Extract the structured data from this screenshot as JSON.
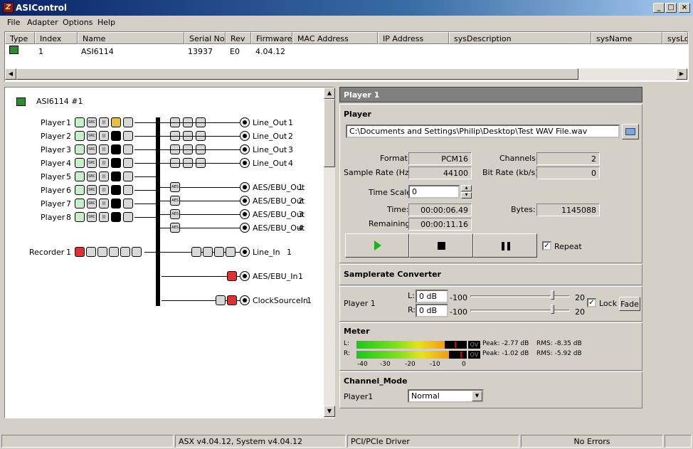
{
  "window": {
    "title": "ASIControl",
    "minimize": "_",
    "maximize": "□",
    "close": "×"
  },
  "menu": [
    "File",
    "Adapter",
    "Options",
    "Help"
  ],
  "devices": {
    "columns": [
      "Type",
      "Index",
      "Name",
      "Serial No.",
      "Rev",
      "Firmware",
      "MAC Address",
      "IP Address",
      "sysDescription",
      "sysName",
      "sysLo"
    ],
    "rows": [
      {
        "index": "1",
        "name": "ASI6114",
        "serial": "13937",
        "rev": "E0",
        "firmware": "4.04.12"
      }
    ]
  },
  "routing": {
    "adapter": "ASI6114 #1",
    "players": [
      {
        "label": "Player",
        "num": "1"
      },
      {
        "label": "Player",
        "num": "2"
      },
      {
        "label": "Player",
        "num": "3"
      },
      {
        "label": "Player",
        "num": "4"
      },
      {
        "label": "Player",
        "num": "5"
      },
      {
        "label": "Player",
        "num": "6"
      },
      {
        "label": "Player",
        "num": "7"
      },
      {
        "label": "Player",
        "num": "8"
      }
    ],
    "outputs": [
      {
        "label": "Line_Out",
        "num": "1"
      },
      {
        "label": "Line_Out",
        "num": "2"
      },
      {
        "label": "Line_Out",
        "num": "3"
      },
      {
        "label": "Line_Out",
        "num": "4"
      },
      {
        "label": "AES/EBU_Out",
        "num": "1"
      },
      {
        "label": "AES/EBU_Out",
        "num": "2"
      },
      {
        "label": "AES/EBU_Out",
        "num": "3"
      },
      {
        "label": "AES/EBU_Out",
        "num": "4"
      }
    ],
    "recorder": {
      "label": "Recorder",
      "num": "1"
    },
    "inputs": [
      {
        "label": "Line_In",
        "num": "1"
      },
      {
        "label": "AES/EBU_In",
        "num": "1"
      },
      {
        "label": "ClockSourceIn",
        "num": "1"
      }
    ]
  },
  "panel": {
    "title": "Player  1",
    "player": {
      "heading": "Player",
      "file": "C:\\Documents and Settings\\Philip\\Desktop\\Test WAV File.wav",
      "format_label": "Format:",
      "format": "PCM16",
      "channels_label": "Channels:",
      "channels": "2",
      "samplerate_label": "Sample Rate (Hz):",
      "samplerate": "44100",
      "bitrate_label": "Bit Rate (kb/s):",
      "bitrate": "0",
      "timescale_label": "Time Scale:",
      "timescale": "0",
      "time_label": "Time:",
      "time": "00:00:06.49",
      "bytes_label": "Bytes:",
      "bytes": "1145088",
      "remaining_label": "Remaining:",
      "remaining": "00:00:11.16",
      "repeat_label": "Repeat",
      "repeat_checked": true
    },
    "src": {
      "heading": "Samplerate Converter",
      "row_label": "Player  1",
      "l_label": "L:",
      "l_value": "0 dB",
      "l_min": "-100",
      "l_max": "20",
      "r_label": "R:",
      "r_value": "0 dB",
      "r_min": "-100",
      "r_max": "20",
      "lock_label": "Lock",
      "lock_checked": true,
      "fade_label": "Fade"
    },
    "meter": {
      "heading": "Meter",
      "l_label": "L:",
      "r_label": "R:",
      "l_ov": "OV",
      "r_ov": "OV",
      "l_peak": "Peak: -2.77 dB",
      "l_rms": "RMS: -8.35 dB",
      "r_peak": "Peak: -1.02 dB",
      "r_rms": "RMS: -5.92 dB",
      "scale": [
        "-40",
        "-30",
        "-20",
        "-10",
        "0"
      ],
      "l_level": 0.8,
      "r_level": 0.84
    },
    "channel_mode": {
      "heading": "Channel_Mode",
      "row_label": "Player1",
      "value": "Normal"
    }
  },
  "status": {
    "version": "ASX v4.04.12, System v4.04.12",
    "driver": "PCI/PCIe Driver",
    "errors": "No Errors"
  }
}
